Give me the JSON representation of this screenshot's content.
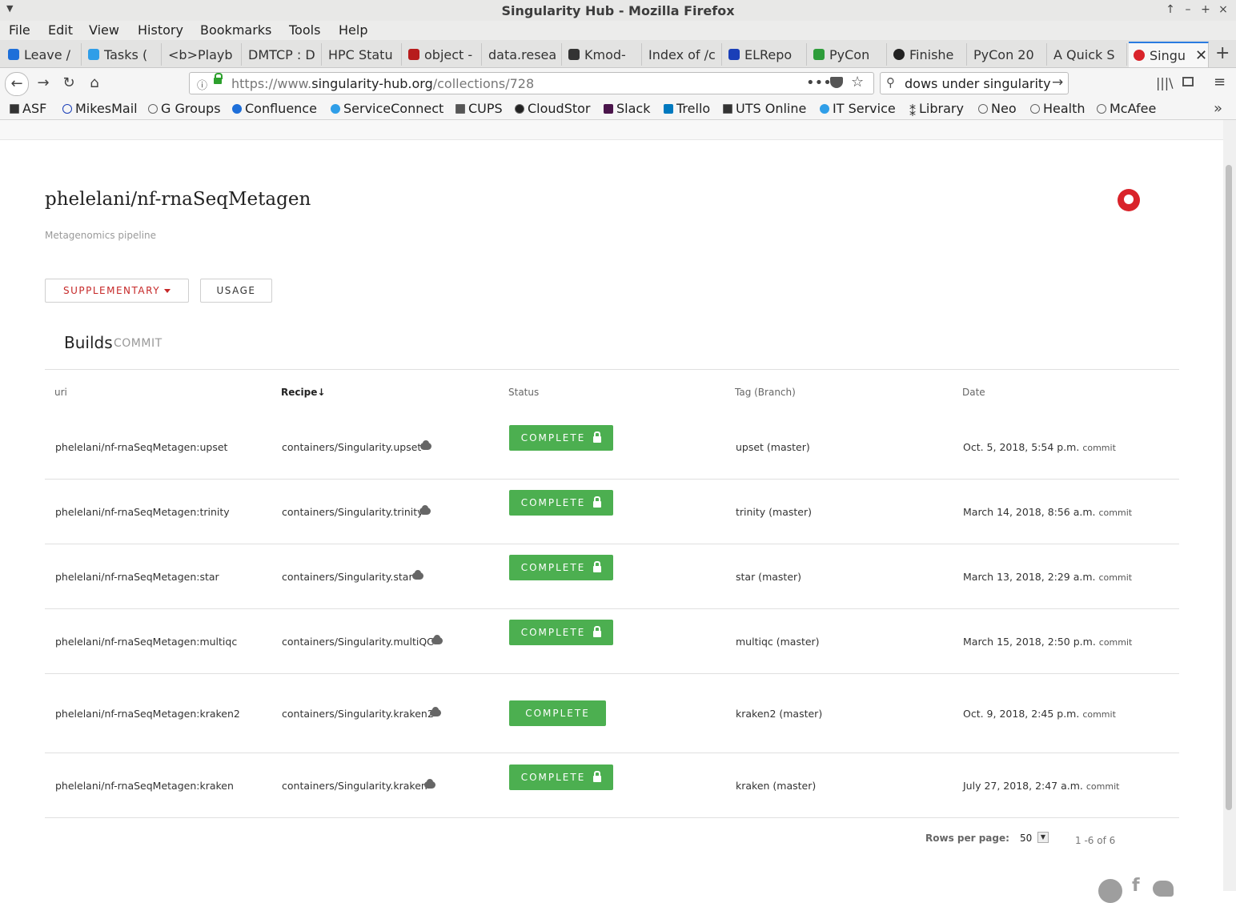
{
  "window": {
    "title": "Singularity Hub - Mozilla Firefox"
  },
  "menubar": [
    "File",
    "Edit",
    "View",
    "History",
    "Bookmarks",
    "Tools",
    "Help"
  ],
  "tabs": [
    {
      "label": "Leave /",
      "color": "#1e6fd9"
    },
    {
      "label": "Tasks (",
      "color": "#2f9ee8"
    },
    {
      "label": "<b>Playb",
      "color": ""
    },
    {
      "label": "DMTCP : D",
      "color": ""
    },
    {
      "label": "HPC Statu",
      "color": ""
    },
    {
      "label": "object -",
      "color": "#b71c1c"
    },
    {
      "label": "data.resea",
      "color": ""
    },
    {
      "label": "Kmod-",
      "color": "#333333"
    },
    {
      "label": "Index of /c",
      "color": ""
    },
    {
      "label": "ELRepo",
      "color": "#1a3fb8"
    },
    {
      "label": "PyCon",
      "color": "#2e9d3a"
    },
    {
      "label": "Finishe",
      "color": "#222222"
    },
    {
      "label": "PyCon 20",
      "color": ""
    },
    {
      "label": "A Quick S",
      "color": ""
    },
    {
      "label": "Singu",
      "color": "#d9232a"
    }
  ],
  "nav": {
    "url_prefix": "https://www.",
    "url_domain": "singularity-hub.org",
    "url_path": "/collections/728",
    "search_value": "dows under singularity"
  },
  "bookmarks": [
    "ASF",
    "MikesMail",
    "G Groups",
    "Confluence",
    "ServiceConnect",
    "CUPS",
    "CloudStor",
    "Slack",
    "Trello",
    "UTS Online",
    "IT Service",
    "Library",
    "Neo",
    "Health",
    "McAfee"
  ],
  "page": {
    "collection_name": "phelelani/nf-rnaSeqMetagen",
    "description": "Metagenomics pipeline",
    "supplementary_label": "SUPPLEMENTARY",
    "usage_label": "USAGE",
    "builds_title": "Builds",
    "commit_tab": "COMMIT"
  },
  "table": {
    "headers": {
      "uri": "uri",
      "recipe": "Recipe",
      "sort_arrow": "↓",
      "status": "Status",
      "tag": "Tag (Branch)",
      "date": "Date"
    },
    "rows": [
      {
        "uri": "phelelani/nf-rnaSeqMetagen:upset",
        "recipe": "containers/Singularity.upset",
        "status": "COMPLETE",
        "tag": "upset (master)",
        "date": "Oct. 5, 2018, 5:54 p.m.",
        "commit": "commit"
      },
      {
        "uri": "phelelani/nf-rnaSeqMetagen:trinity",
        "recipe": "containers/Singularity.trinity",
        "status": "COMPLETE",
        "tag": "trinity (master)",
        "date": "March 14, 2018, 8:56 a.m.",
        "commit": "commit"
      },
      {
        "uri": "phelelani/nf-rnaSeqMetagen:star",
        "recipe": "containers/Singularity.star",
        "status": "COMPLETE",
        "tag": "star (master)",
        "date": "March 13, 2018, 2:29 a.m.",
        "commit": "commit"
      },
      {
        "uri": "phelelani/nf-rnaSeqMetagen:multiqc",
        "recipe": "containers/Singularity.multiQC",
        "status": "COMPLETE",
        "tag": "multiqc (master)",
        "date": "March 15, 2018, 2:50 p.m.",
        "commit": "commit"
      },
      {
        "uri": "phelelani/nf-rnaSeqMetagen:kraken2",
        "recipe": "containers/Singularity.kraken2",
        "status": "COMPLETE",
        "tag": "kraken2 (master)",
        "date": "Oct. 9, 2018, 2:45 p.m.",
        "commit": "commit"
      },
      {
        "uri": "phelelani/nf-rnaSeqMetagen:kraken",
        "recipe": "containers/Singularity.kraken",
        "status": "COMPLETE",
        "tag": "kraken (master)",
        "date": "July 27, 2018, 2:47 a.m.",
        "commit": "commit"
      }
    ],
    "rows_per_page_label": "Rows per page:",
    "rows_per_page_value": "50",
    "pagination": "1 -6 of 6"
  }
}
